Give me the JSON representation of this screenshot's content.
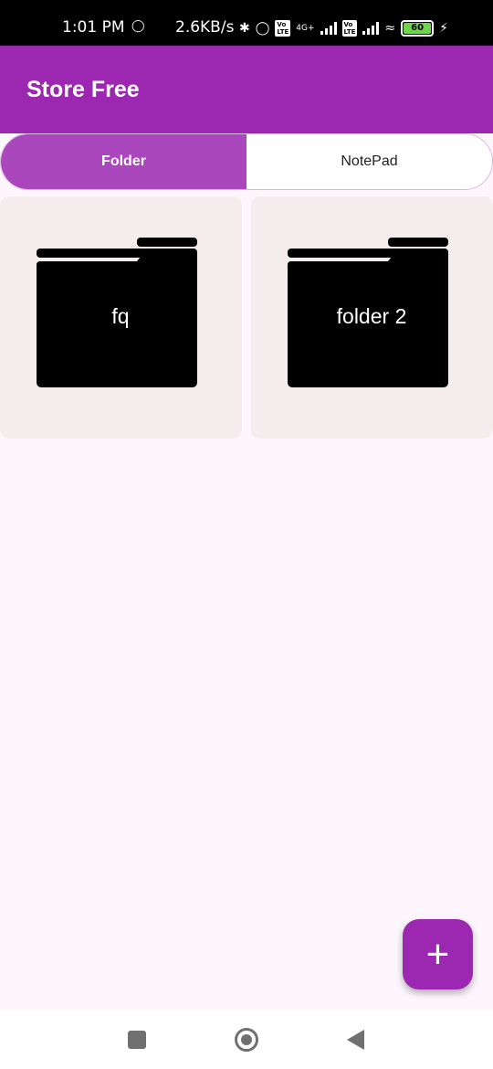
{
  "status_bar": {
    "time": "1:01 PM",
    "sim_icon": "sim-icon",
    "speed": "2.6KB/s",
    "network_type": "4G+",
    "volte_label": "Vo\nLTE",
    "battery_level": "60"
  },
  "app_bar": {
    "title": "Store Free",
    "color": "#9c27b0"
  },
  "tabs": [
    {
      "label": "Folder",
      "active": true
    },
    {
      "label": "NotePad",
      "active": false
    }
  ],
  "folders": [
    {
      "name": "fq",
      "icon": "folder-icon"
    },
    {
      "name": "folder 2",
      "icon": "folder-icon"
    }
  ],
  "fab": {
    "label": "+",
    "icon": "plus-icon"
  },
  "nav_bar": {
    "recents": "recents-icon",
    "home": "home-icon",
    "back": "back-icon"
  },
  "colors": {
    "accent": "#9c27b0",
    "tab_active": "#ab47bc",
    "card_bg": "#f5eded"
  }
}
